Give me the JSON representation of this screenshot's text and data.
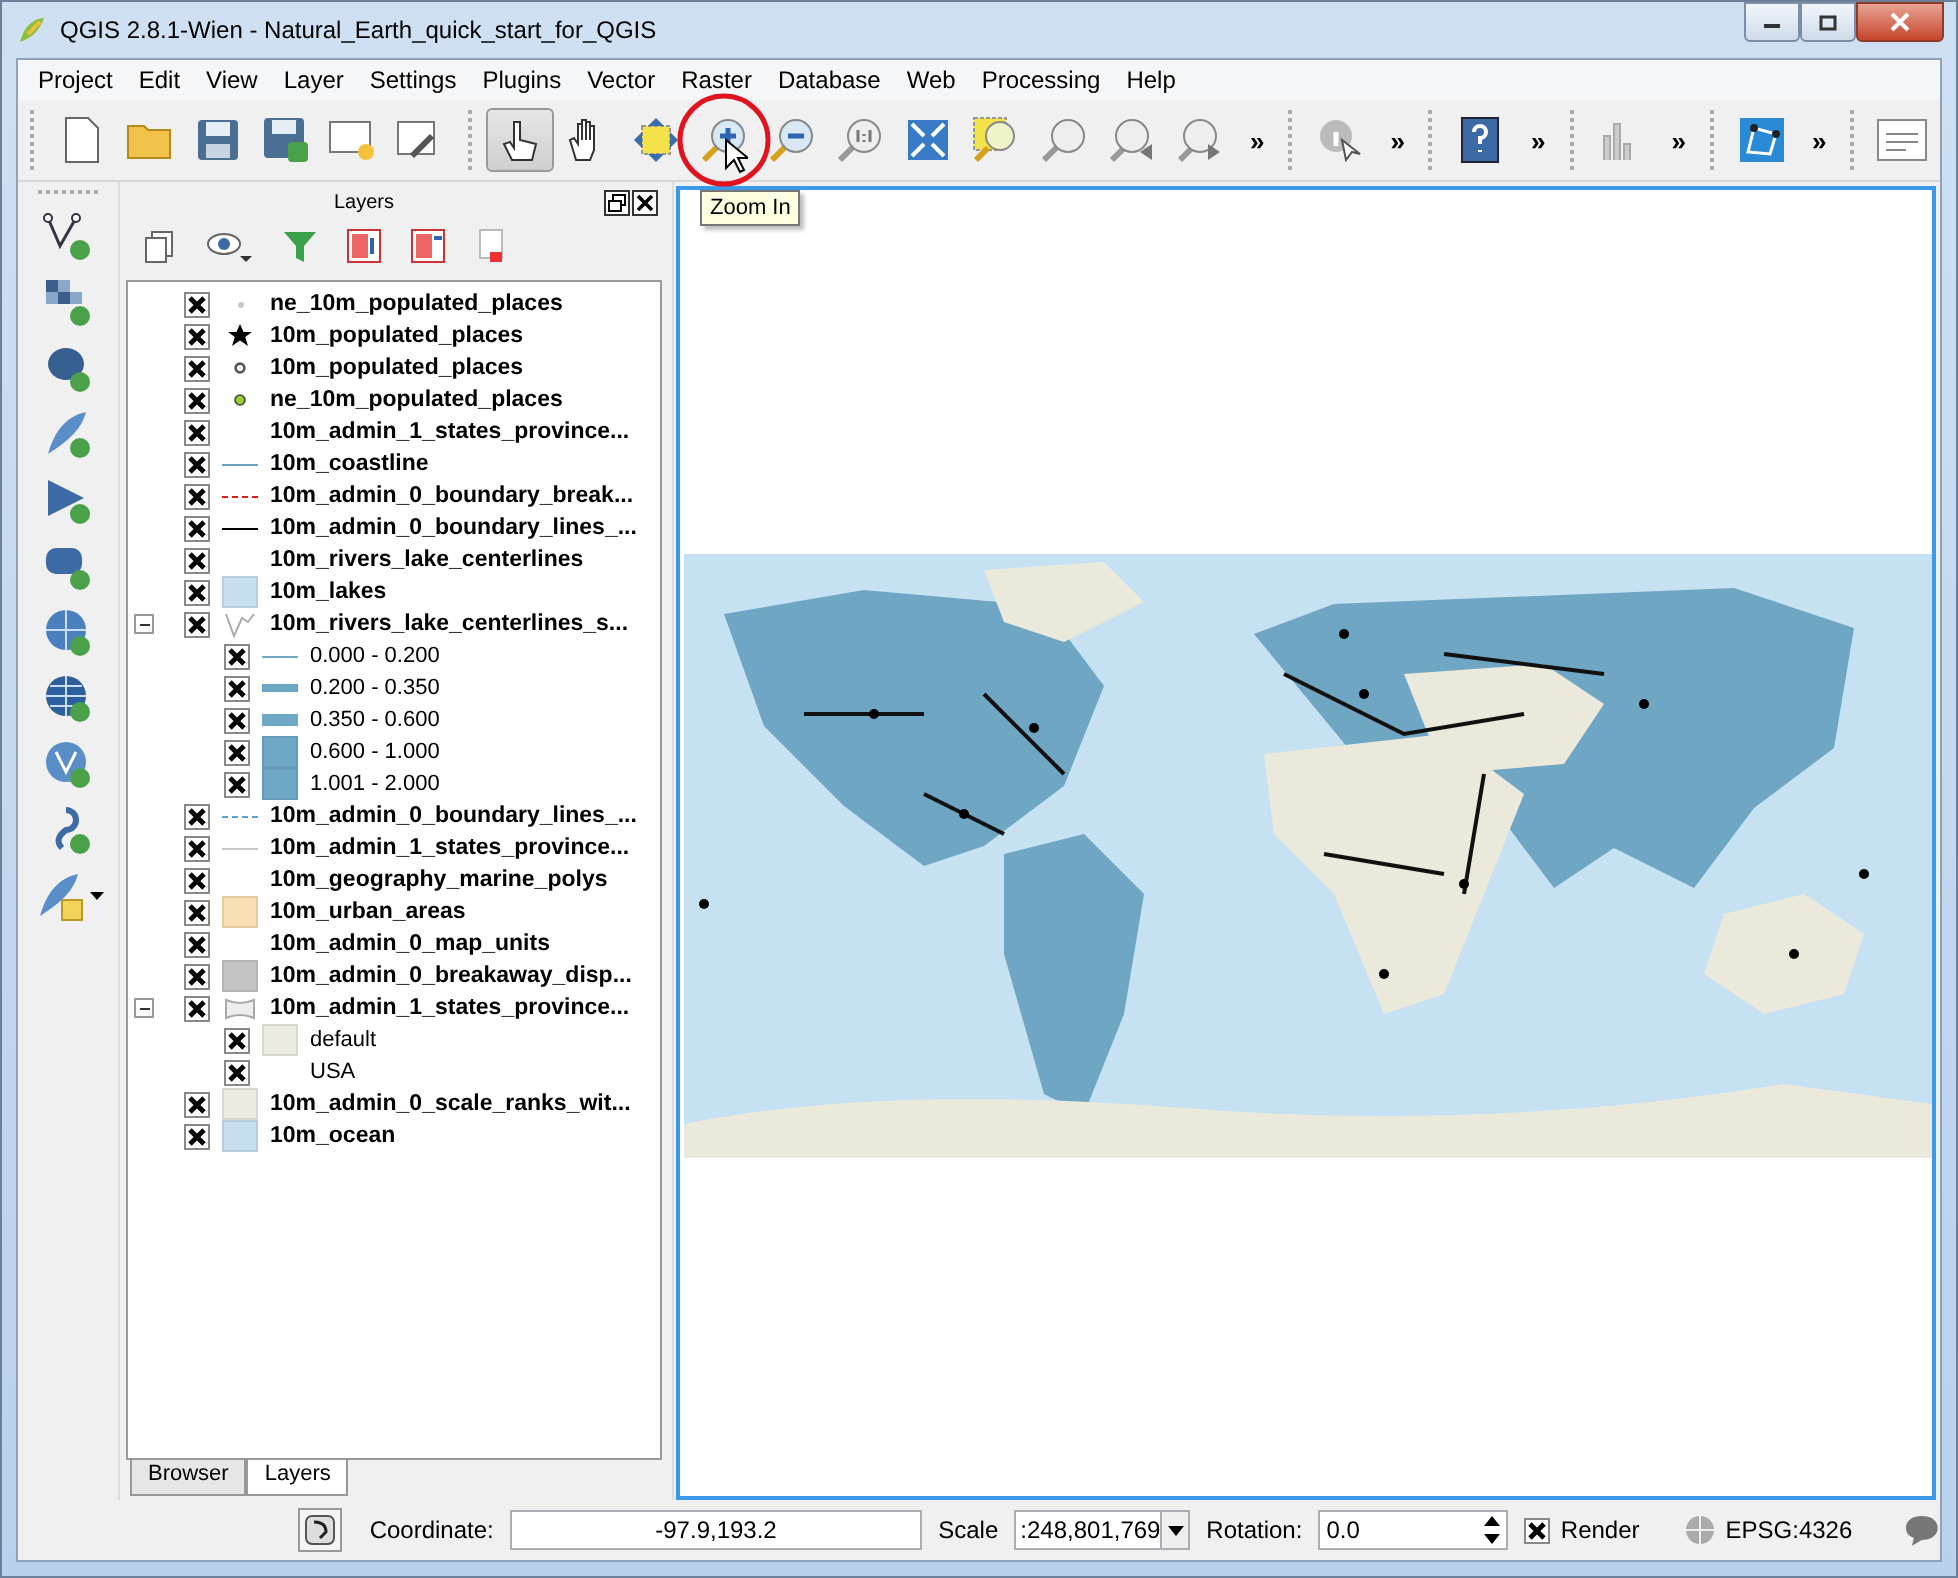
{
  "window": {
    "title": "QGIS 2.8.1-Wien - Natural_Earth_quick_start_for_QGIS"
  },
  "menu": [
    "Project",
    "Edit",
    "View",
    "Layer",
    "Settings",
    "Plugins",
    "Vector",
    "Raster",
    "Database",
    "Web",
    "Processing",
    "Help"
  ],
  "toolbar": {
    "groups": [
      {
        "buttons": [
          {
            "selected": false
          },
          {
            "selected": false
          },
          {
            "selected": false
          },
          {
            "selected": false
          },
          {
            "selected": false
          },
          {
            "selected": false
          }
        ]
      },
      {
        "buttons": [
          {
            "selected": true
          },
          {
            "selected": false
          },
          {
            "selected": false
          },
          {
            "selected": false,
            "circled": true
          },
          {
            "selected": false
          },
          {
            "selected": false
          },
          {
            "selected": false
          },
          {
            "selected": false
          },
          {
            "selected": false
          },
          {
            "selected": false
          },
          {
            "selected": false
          }
        ],
        "overflow": "»"
      },
      {
        "buttons": [
          {
            "selected": false
          }
        ],
        "overflow": "»"
      },
      {
        "buttons": [
          {
            "selected": false
          }
        ],
        "overflow": "»"
      },
      {
        "buttons": [
          {
            "selected": false
          }
        ],
        "overflow": "»"
      },
      {
        "buttons": [
          {
            "selected": false
          }
        ],
        "overflow": "»"
      },
      {
        "buttons": [
          {
            "selected": false
          }
        ]
      }
    ],
    "tooltip": "Zoom In"
  },
  "layers_panel": {
    "title": "Layers",
    "layers": [
      {
        "name": "ne_10m_populated_places",
        "checked": true,
        "kind": "pixel",
        "color": "#c8c8c8"
      },
      {
        "name": "10m_populated_places",
        "checked": true,
        "kind": "star",
        "color": "#000000"
      },
      {
        "name": "10m_populated_places",
        "checked": true,
        "kind": "circle",
        "color": "#555555"
      },
      {
        "name": "ne_10m_populated_places",
        "checked": true,
        "kind": "dot",
        "color": "#9acd32"
      },
      {
        "name": "10m_admin_1_states_province...",
        "checked": true,
        "kind": "plain"
      },
      {
        "name": "10m_coastline",
        "checked": true,
        "kind": "line",
        "color": "#6a9fc0"
      },
      {
        "name": "10m_admin_0_boundary_break...",
        "checked": true,
        "kind": "dashed",
        "color": "#e31a1c"
      },
      {
        "name": "10m_admin_0_boundary_lines_...",
        "checked": true,
        "kind": "line",
        "color": "#000000"
      },
      {
        "name": "10m_rivers_lake_centerlines",
        "checked": true,
        "kind": "plain"
      },
      {
        "name": "10m_lakes",
        "checked": true,
        "kind": "fill",
        "color": "#c6e0f0"
      },
      {
        "name": "10m_rivers_lake_centerlines_s...",
        "checked": true,
        "kind": "graduated",
        "expanded": true,
        "children": [
          {
            "name": "0.000 - 0.200",
            "checked": true,
            "kind": "line",
            "color": "#6fa8c6"
          },
          {
            "name": "0.200 - 0.350",
            "checked": true,
            "kind": "thick",
            "color": "#6fa8c6"
          },
          {
            "name": "0.350 - 0.600",
            "checked": true,
            "kind": "bar",
            "color": "#6fa8c6"
          },
          {
            "name": "0.600 - 1.000",
            "checked": true,
            "kind": "fill",
            "color": "#6fa8c6"
          },
          {
            "name": "1.001 - 2.000",
            "checked": true,
            "kind": "fill",
            "color": "#6fa8c6"
          }
        ]
      },
      {
        "name": "10m_admin_0_boundary_lines_...",
        "checked": true,
        "kind": "dashed",
        "color": "#5aa0c8"
      },
      {
        "name": "10m_admin_1_states_province...",
        "checked": true,
        "kind": "line",
        "color": "#c8c8c8"
      },
      {
        "name": "10m_geography_marine_polys",
        "checked": true,
        "kind": "plain"
      },
      {
        "name": "10m_urban_areas",
        "checked": true,
        "kind": "fill",
        "color": "#f8dfb4"
      },
      {
        "name": "10m_admin_0_map_units",
        "checked": true,
        "kind": "plain"
      },
      {
        "name": "10m_admin_0_breakaway_disp...",
        "checked": true,
        "kind": "fill",
        "color": "#c4c4c4"
      },
      {
        "name": "10m_admin_1_states_province...",
        "checked": true,
        "kind": "categorized",
        "expanded": true,
        "children": [
          {
            "name": "default",
            "checked": true,
            "kind": "fill",
            "color": "#ecebe0"
          },
          {
            "name": "USA",
            "checked": true,
            "kind": "plain"
          }
        ]
      },
      {
        "name": "10m_admin_0_scale_ranks_wit...",
        "checked": true,
        "kind": "fill",
        "color": "#ecebe0"
      },
      {
        "name": "10m_ocean",
        "checked": true,
        "kind": "fill",
        "color": "#c5dff0"
      }
    ],
    "tabs": [
      {
        "label": "Browser",
        "selected": false
      },
      {
        "label": "Layers",
        "selected": true
      }
    ]
  },
  "status_bar": {
    "coordinate_label": "Coordinate:",
    "coordinate": "-97.9,193.2",
    "scale_label": "Scale",
    "scale": ":248,801,769",
    "rotation_label": "Rotation:",
    "rotation": "0.0",
    "render": {
      "label": "Render",
      "checked": true
    },
    "crs": "EPSG:4326"
  }
}
